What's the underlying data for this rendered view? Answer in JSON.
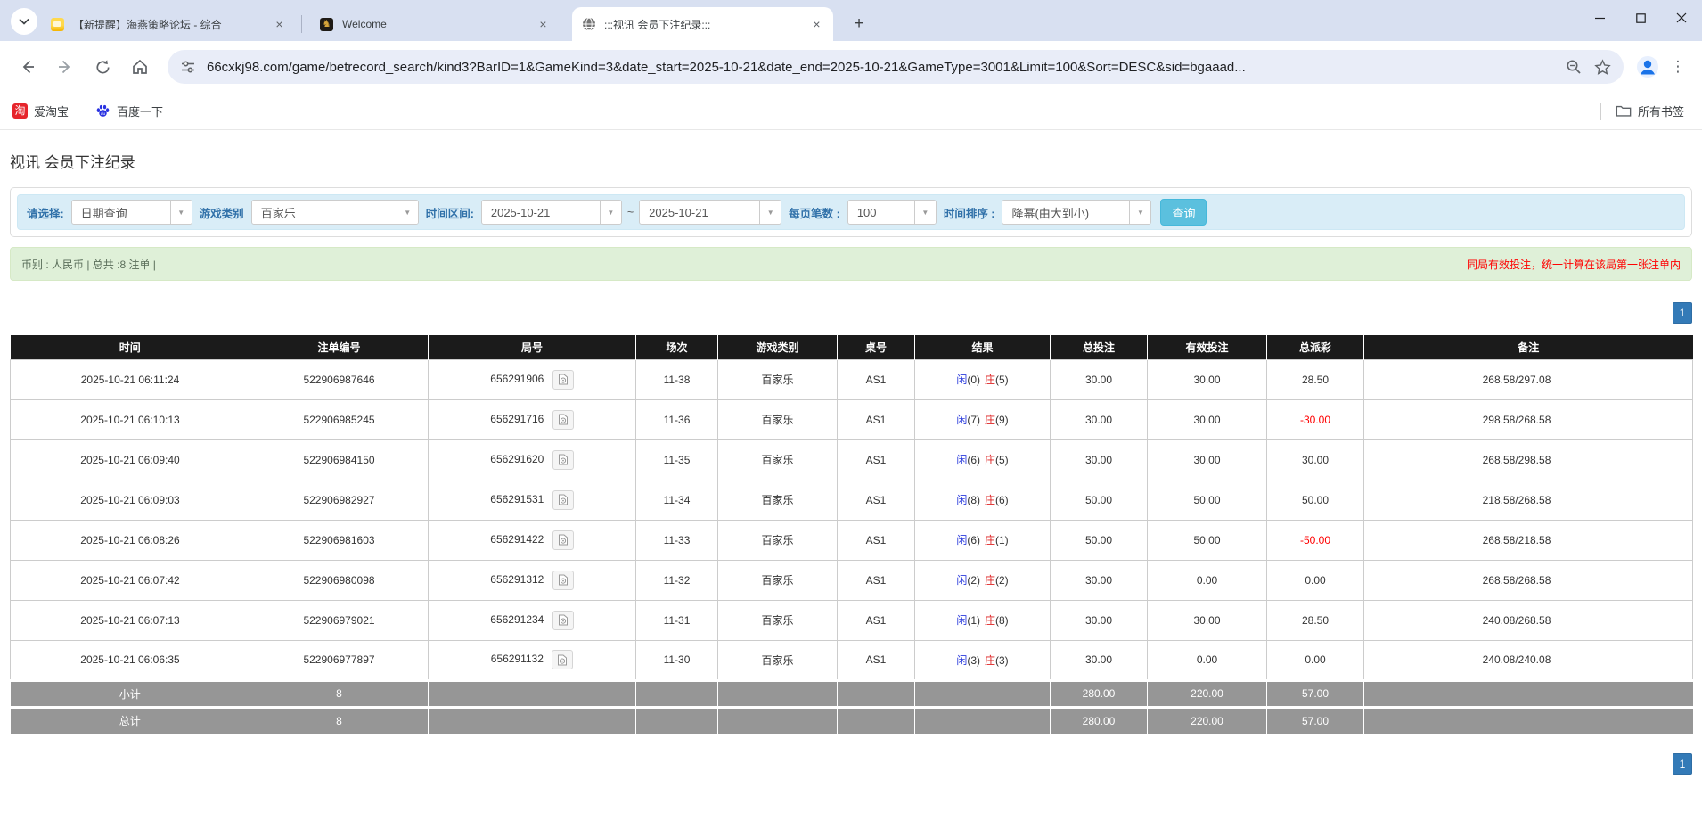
{
  "colors": {
    "accent_blue": "#337ab7",
    "filter_bg": "#d9edf7",
    "info_bg": "#dff0d8",
    "header_bg": "#1b1b1b",
    "summary_bg": "#969696",
    "player_blue": "#2b3bdc",
    "banker_red": "#dd2222",
    "alert_red": "#ff0000",
    "search_btn": "#5bc0de"
  },
  "browser": {
    "tabs": [
      {
        "title": "【新提醒】海燕策略论坛 - 综合",
        "active": false
      },
      {
        "title": "Welcome",
        "active": false
      },
      {
        "title": ":::视讯 会员下注纪录:::",
        "active": true
      }
    ],
    "new_tab_glyph": "+",
    "close_glyph": "×",
    "url": "66cxkj98.com/game/betrecord_search/kind3?BarID=1&GameKind=3&date_start=2025-10-21&date_end=2025-10-21&GameType=3001&Limit=100&Sort=DESC&sid=bgaaad...",
    "bookmarks": [
      {
        "label": "爱淘宝"
      },
      {
        "label": "百度一下"
      }
    ],
    "all_bookmarks_label": "所有书签",
    "tao_glyph": "淘",
    "welcome_fav_glyph": "♞",
    "menu_glyph": "⋮"
  },
  "page": {
    "title": "视讯 会员下注纪录",
    "filters": {
      "select_label": "请选择:",
      "select_value": "日期查询",
      "game_kind_label": "游戏类别",
      "game_kind_value": "百家乐",
      "date_range_label": "时间区间:",
      "date_start": "2025-10-21",
      "tilde": "~",
      "date_end": "2025-10-21",
      "page_size_label": "每页笔数 :",
      "page_size_value": "100",
      "sort_label": "时间排序 :",
      "sort_value": "降幂(由大到小)",
      "search_button": "查询",
      "arrow_glyph": "▼"
    },
    "info_bar": {
      "left": "币别 : 人民币 | 总共 :8 注单 |",
      "right": "同局有效投注，统一计算在该局第一张注单内"
    },
    "pagination": "1",
    "table": {
      "headers": [
        "时间",
        "注单编号",
        "局号",
        "场次",
        "游戏类别",
        "桌号",
        "结果",
        "总投注",
        "有效投注",
        "总派彩",
        "备注"
      ],
      "rows": [
        {
          "time": "2025-10-21 06:11:24",
          "bet_id": "522906987646",
          "round_id": "656291906",
          "session": "11-38",
          "game": "百家乐",
          "table_no": "AS1",
          "player": "闲",
          "player_n": "(0)",
          "banker": "庄",
          "banker_n": "(5)",
          "total_bet": "30.00",
          "valid_bet": "30.00",
          "payout": "28.50",
          "note": "268.58/297.08"
        },
        {
          "time": "2025-10-21 06:10:13",
          "bet_id": "522906985245",
          "round_id": "656291716",
          "session": "11-36",
          "game": "百家乐",
          "table_no": "AS1",
          "player": "闲",
          "player_n": "(7)",
          "banker": "庄",
          "banker_n": "(9)",
          "total_bet": "30.00",
          "valid_bet": "30.00",
          "payout": "-30.00",
          "note": "298.58/268.58"
        },
        {
          "time": "2025-10-21 06:09:40",
          "bet_id": "522906984150",
          "round_id": "656291620",
          "session": "11-35",
          "game": "百家乐",
          "table_no": "AS1",
          "player": "闲",
          "player_n": "(6)",
          "banker": "庄",
          "banker_n": "(5)",
          "total_bet": "30.00",
          "valid_bet": "30.00",
          "payout": "30.00",
          "note": "268.58/298.58"
        },
        {
          "time": "2025-10-21 06:09:03",
          "bet_id": "522906982927",
          "round_id": "656291531",
          "session": "11-34",
          "game": "百家乐",
          "table_no": "AS1",
          "player": "闲",
          "player_n": "(8)",
          "banker": "庄",
          "banker_n": "(6)",
          "total_bet": "50.00",
          "valid_bet": "50.00",
          "payout": "50.00",
          "note": "218.58/268.58"
        },
        {
          "time": "2025-10-21 06:08:26",
          "bet_id": "522906981603",
          "round_id": "656291422",
          "session": "11-33",
          "game": "百家乐",
          "table_no": "AS1",
          "player": "闲",
          "player_n": "(6)",
          "banker": "庄",
          "banker_n": "(1)",
          "total_bet": "50.00",
          "valid_bet": "50.00",
          "payout": "-50.00",
          "note": "268.58/218.58"
        },
        {
          "time": "2025-10-21 06:07:42",
          "bet_id": "522906980098",
          "round_id": "656291312",
          "session": "11-32",
          "game": "百家乐",
          "table_no": "AS1",
          "player": "闲",
          "player_n": "(2)",
          "banker": "庄",
          "banker_n": "(2)",
          "total_bet": "30.00",
          "valid_bet": "0.00",
          "payout": "0.00",
          "note": "268.58/268.58"
        },
        {
          "time": "2025-10-21 06:07:13",
          "bet_id": "522906979021",
          "round_id": "656291234",
          "session": "11-31",
          "game": "百家乐",
          "table_no": "AS1",
          "player": "闲",
          "player_n": "(1)",
          "banker": "庄",
          "banker_n": "(8)",
          "total_bet": "30.00",
          "valid_bet": "30.00",
          "payout": "28.50",
          "note": "240.08/268.58"
        },
        {
          "time": "2025-10-21 06:06:35",
          "bet_id": "522906977897",
          "round_id": "656291132",
          "session": "11-30",
          "game": "百家乐",
          "table_no": "AS1",
          "player": "闲",
          "player_n": "(3)",
          "banker": "庄",
          "banker_n": "(3)",
          "total_bet": "30.00",
          "valid_bet": "0.00",
          "payout": "0.00",
          "note": "240.08/240.08"
        }
      ],
      "subtotal": {
        "label": "小计",
        "count": "8",
        "total_bet": "280.00",
        "valid_bet": "220.00",
        "payout": "57.00"
      },
      "total": {
        "label": "总计",
        "count": "8",
        "total_bet": "280.00",
        "valid_bet": "220.00",
        "payout": "57.00"
      }
    }
  }
}
